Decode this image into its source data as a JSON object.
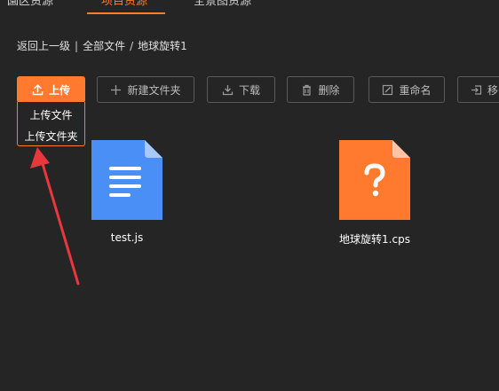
{
  "tabs": [
    {
      "label": "園区资源"
    },
    {
      "label": "项目资源"
    },
    {
      "label": "全景图资源"
    }
  ],
  "breadcrumb": {
    "back": "返回上一级",
    "divider": "|",
    "root": "全部文件",
    "slash": "/",
    "current": "地球旋转1"
  },
  "toolbar": {
    "upload": "上传",
    "new_folder": "新建文件夹",
    "download": "下载",
    "delete": "删除",
    "rename": "重命名",
    "move": "移"
  },
  "upload_menu": {
    "items": [
      {
        "label": "上传文件"
      },
      {
        "label": "上传文件夹"
      }
    ]
  },
  "files": [
    {
      "name": "test.js",
      "icon": "document-icon",
      "color": "#4a8ff5"
    },
    {
      "name": "地球旋转1.cps",
      "icon": "unknown-file-icon",
      "color": "#ff7a2e"
    }
  ],
  "colors": {
    "accent": "#ff7a2e",
    "background": "#252526",
    "annotation_arrow": "#e8383d"
  }
}
